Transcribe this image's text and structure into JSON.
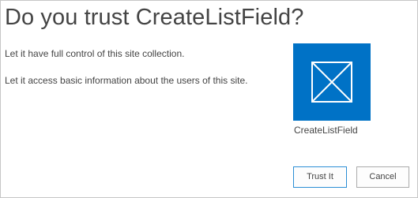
{
  "dialog": {
    "title": "Do you trust CreateListField?",
    "permissions": [
      "Let it have full control of this site collection.",
      "Let it access basic information about the users of this site."
    ],
    "app": {
      "name": "CreateListField",
      "icon": "app-placeholder-icon",
      "tile_color": "#0072c6"
    },
    "buttons": {
      "trust_label": "Trust It",
      "cancel_label": "Cancel"
    }
  }
}
